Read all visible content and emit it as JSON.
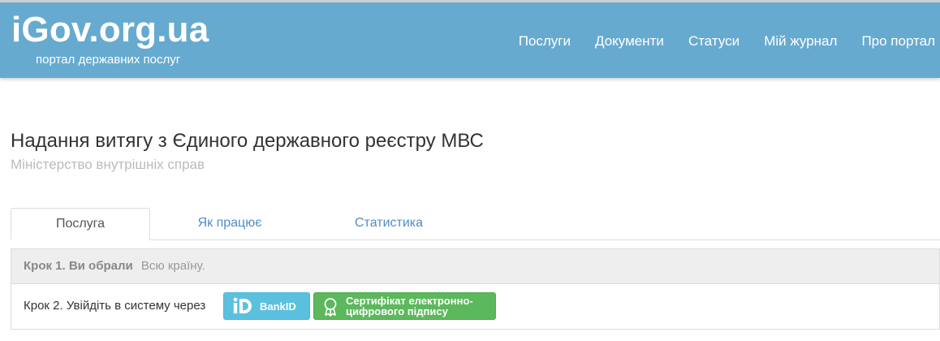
{
  "header": {
    "logo": "iGov.org.ua",
    "tagline": "портал державних послуг",
    "nav": [
      "Послуги",
      "Документи",
      "Статуси",
      "Мій журнал",
      "Про портал"
    ]
  },
  "page": {
    "title": "Надання витягу з Єдиного державного реєстру МВС",
    "subtitle": "Міністерство внутрішніх справ"
  },
  "tabs": [
    "Послуга",
    "Як працює",
    "Статистика"
  ],
  "step1": {
    "label": "Крок 1. Ви обрали",
    "value": "Всю країну."
  },
  "step2": {
    "label": "Крок 2. Увійдіть в систему через",
    "bankid_label": "BankID",
    "cert_label": "Сертифікат електронно-цифрового підпису"
  },
  "colors": {
    "header": "#66aad0",
    "bankid": "#5bc0de",
    "cert": "#5cb85c",
    "link": "#4f8cc9"
  }
}
